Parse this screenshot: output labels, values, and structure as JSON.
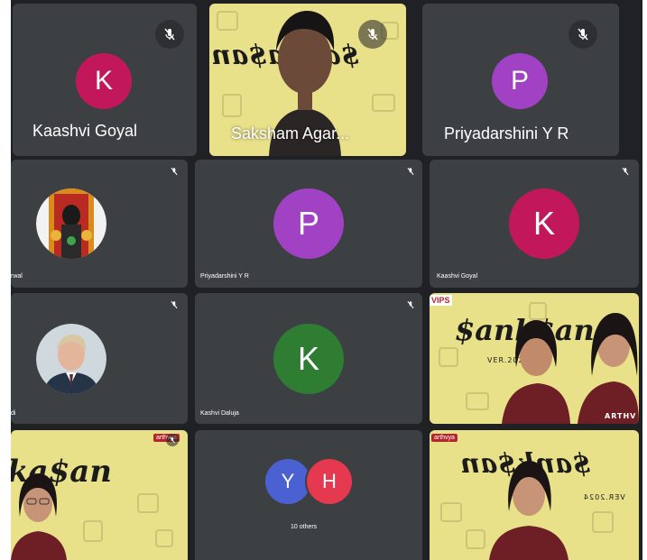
{
  "colors": {
    "tile_bg": "#3c4043",
    "grid_bg": "#202124",
    "avatar_pink": "#c2185b",
    "avatar_purple": "#a142c4",
    "avatar_green": "#2e7d32",
    "avatar_blue": "#4b61d1",
    "avatar_red": "#e53950",
    "video_yellow": "#e9e08a"
  },
  "icons": {
    "mic_off": "microphone-slash"
  },
  "row1": {
    "kaashvi": {
      "initial": "K",
      "name": "Kaashvi Goyal"
    },
    "saksham": {
      "name": "Saksham Agar..."
    },
    "priyadarshini": {
      "initial": "P",
      "name": "Priyadarshini Y R"
    }
  },
  "row2": {
    "photo_tile": {
      "name": "rwal"
    },
    "priyadarshini": {
      "initial": "P",
      "name": "Priyadarshini Y R"
    },
    "kaashvi": {
      "initial": "K",
      "name": "Kaashvi Goyal"
    }
  },
  "row3": {
    "photo_tile": {
      "name": "di"
    },
    "kashvi": {
      "initial": "K",
      "name": "Kashvi Daluja"
    },
    "video_tile": {
      "banner": "$ank$an",
      "version": "VER.2024",
      "logo": "VIPS",
      "brand": "ARTHV"
    }
  },
  "row4": {
    "video_left": {
      "banner": "ka$an",
      "logo": "arthvya"
    },
    "others": {
      "initial_1": "Y",
      "initial_2": "H",
      "label": "10 others"
    },
    "video_right": {
      "banner": "$ank$an",
      "version": "VER.2024",
      "logo": "arthvya"
    }
  }
}
